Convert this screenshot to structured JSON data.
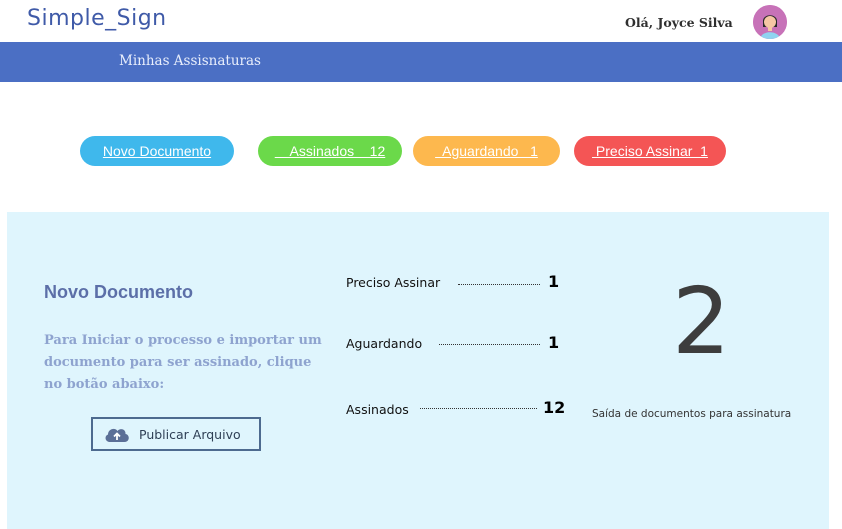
{
  "app": {
    "brand": "Simple_Sign"
  },
  "header": {
    "greeting": "Olá, Joyce Silva"
  },
  "nav": {
    "items": [
      {
        "label": "Minhas Assisnaturas"
      }
    ]
  },
  "filters": {
    "new_document": "Novo Documento",
    "signed": "    Assinados    12",
    "waiting": "  Aguardando   1",
    "must_sign": " Preciso Assinar  1"
  },
  "panel": {
    "title": "Novo Documento",
    "description": "Para Iniciar o processo e importar um documento para ser assinado, clique no botão abaixo:",
    "publish_button": "Publicar Arquivo",
    "stats": [
      {
        "label": "Preciso Assinar",
        "value": "1"
      },
      {
        "label": "Aguardando",
        "value": "1"
      },
      {
        "label": "Assinados",
        "value": "12"
      }
    ],
    "big_number": "2",
    "big_caption": "Saída de documentos para assinatura"
  },
  "colors": {
    "nav": "#4b6fc4",
    "new_document": "#3fb8ec",
    "signed": "#6bd94a",
    "waiting": "#fdb84e",
    "must_sign": "#f45555",
    "panel": "#dff5fd"
  },
  "icons": {
    "avatar": "user-avatar",
    "upload": "cloud-upload-icon"
  }
}
